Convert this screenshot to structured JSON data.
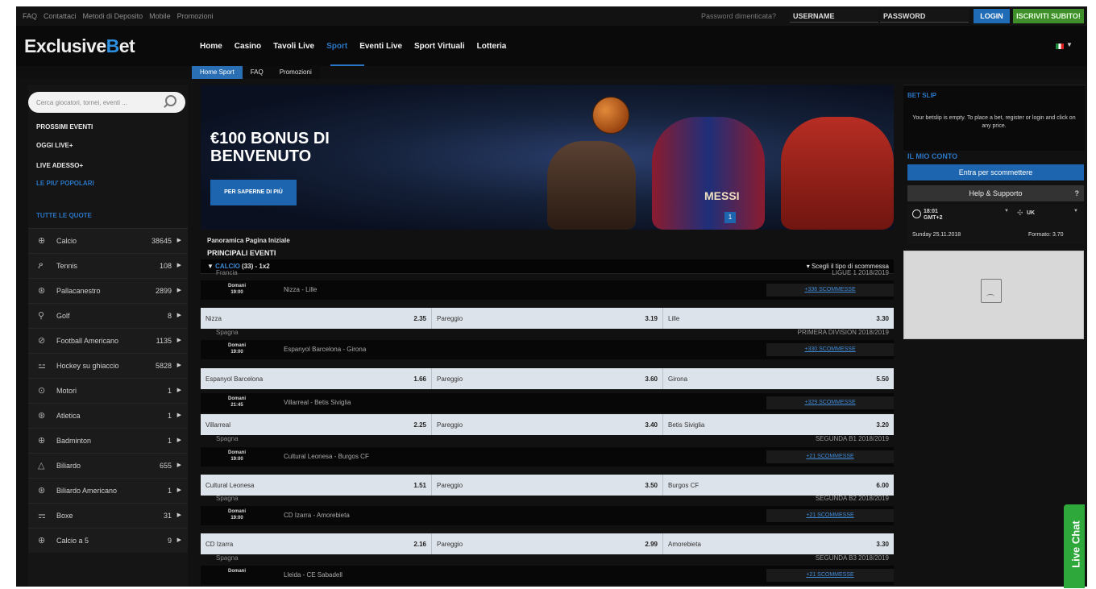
{
  "topbar": {
    "links": [
      "FAQ",
      "Contattaci",
      "Metodi di Deposito",
      "Mobile",
      "Promozioni"
    ],
    "forgot_password": "Password dimenticata?",
    "username_placeholder": "USERNAME",
    "password_placeholder": "PASSWORD",
    "login_label": "LOGIN",
    "signup_label": "ISCRIVITI SUBITO!"
  },
  "header": {
    "logo_prefix": "Exclusive",
    "logo_b": "B",
    "logo_suffix": "et",
    "nav": [
      "Home",
      "Casino",
      "Tavoli Live",
      "Sport",
      "Eventi Live",
      "Sport Virtuali",
      "Lotteria"
    ],
    "active_nav": "Sport"
  },
  "subnav": {
    "items": [
      "Home Sport",
      "FAQ",
      "Promozioni"
    ],
    "active": "Home Sport"
  },
  "sidebar": {
    "search_placeholder": "Cerca giocatori, tornei, eventi ...",
    "quick_links": [
      "PROSSIMI EVENTI",
      "OGGI LIVE+",
      "LIVE ADESSO+",
      "LE PIU' POPOLARI",
      "TUTTE LE QUOTE"
    ],
    "sports": [
      {
        "name": "Calcio",
        "count": "38645",
        "icon": "soccer-ball-icon",
        "glyph": "⊕"
      },
      {
        "name": "Tennis",
        "count": "108",
        "icon": "tennis-racket-icon",
        "glyph": "ዖ"
      },
      {
        "name": "Pallacanestro",
        "count": "2899",
        "icon": "basketball-icon",
        "glyph": "⊛"
      },
      {
        "name": "Golf",
        "count": "8",
        "icon": "golf-icon",
        "glyph": "⚲"
      },
      {
        "name": "Football Americano",
        "count": "1135",
        "icon": "american-football-icon",
        "glyph": "⊘"
      },
      {
        "name": "Hockey su ghiaccio",
        "count": "5828",
        "icon": "hockey-icon",
        "glyph": "⚍"
      },
      {
        "name": "Motori",
        "count": "1",
        "icon": "motorsport-icon",
        "glyph": "⊙"
      },
      {
        "name": "Atletica",
        "count": "1",
        "icon": "athletics-icon",
        "glyph": "⊛"
      },
      {
        "name": "Badminton",
        "count": "1",
        "icon": "badminton-icon",
        "glyph": "⊕"
      },
      {
        "name": "Biliardo",
        "count": "655",
        "icon": "billiards-icon",
        "glyph": "△"
      },
      {
        "name": "Biliardo Americano",
        "count": "1",
        "icon": "pool-icon",
        "glyph": "⊛"
      },
      {
        "name": "Boxe",
        "count": "31",
        "icon": "boxing-icon",
        "glyph": "⚎"
      },
      {
        "name": "Calcio a 5",
        "count": "9",
        "icon": "futsal-icon",
        "glyph": "⊕"
      }
    ]
  },
  "banner": {
    "title": "€100 BONUS DI BENVENUTO",
    "button": "PER SAPERNE DI PIÙ",
    "jersey": "MESSI",
    "slide": "1"
  },
  "main": {
    "overview": "Panoramica Pagina Iniziale",
    "top_events": "PRINCIPALI EVENTI",
    "calcio_label": "CALCIO",
    "calcio_suffix": "(33) - 1x2",
    "bet_type": "Scegli il tipo di scommessa",
    "matches": [
      {
        "country": "Francia",
        "league": "LIGUE 1 2018/2019",
        "time": "Domani 19:00",
        "name": "Nizza - Lille",
        "bets": "+336 SCOMMESSE",
        "home": "Nizza",
        "home_odd": "2.35",
        "draw": "Pareggio",
        "draw_odd": "3.19",
        "away": "Lille",
        "away_odd": "3.30"
      },
      {
        "country": "Spagna",
        "league": "PRIMERA DIVISION 2018/2019",
        "time": "Domani 19:00",
        "name": "Espanyol Barcelona - Girona",
        "bets": "+330 SCOMMESSE",
        "home": "Espanyol Barcelona",
        "home_odd": "1.66",
        "draw": "Pareggio",
        "draw_odd": "3.60",
        "away": "Girona",
        "away_odd": "5.50"
      },
      {
        "country": "",
        "league": "",
        "time": "Domani 21:45",
        "name": "Villarreal - Betis Siviglia",
        "bets": "+329 SCOMMESSE",
        "home": "Villarreal",
        "home_odd": "2.25",
        "draw": "Pareggio",
        "draw_odd": "3.40",
        "away": "Betis Siviglia",
        "away_odd": "3.20"
      },
      {
        "country": "Spagna",
        "league": "SEGUNDA B1 2018/2019",
        "time": "Domani 19:00",
        "name": "Cultural Leonesa - Burgos CF",
        "bets": "+21 SCOMMESSE",
        "home": "Cultural Leonesa",
        "home_odd": "1.51",
        "draw": "Pareggio",
        "draw_odd": "3.50",
        "away": "Burgos CF",
        "away_odd": "6.00"
      },
      {
        "country": "Spagna",
        "league": "SEGUNDA B2 2018/2019",
        "time": "Domani 19:00",
        "name": "CD Izarra - Amorebieta",
        "bets": "+21 SCOMMESSE",
        "home": "CD Izarra",
        "home_odd": "2.16",
        "draw": "Pareggio",
        "draw_odd": "2.99",
        "away": "Amorebieta",
        "away_odd": "3.30"
      },
      {
        "country": "Spagna",
        "league": "SEGUNDA B3 2018/2019",
        "time": "Domani",
        "name": "Lleida - CE Sabadell",
        "bets": "+21 SCOMMESSE"
      }
    ]
  },
  "right": {
    "betslip_title": "BET SLIP",
    "betslip_message": "Your betslip is empty. To place a bet, register or login and click on any price.",
    "account_title": "IL MIO CONTO",
    "enter_btn": "Entra per scommettere",
    "help_btn": "Help & Supporto",
    "help_q": "?",
    "time": "18:01",
    "timezone": "GMT+2",
    "lang": "UK",
    "date": "Sunday 25.11.2018",
    "format": "Formato: 3.70"
  },
  "livechat": "Live Chat"
}
